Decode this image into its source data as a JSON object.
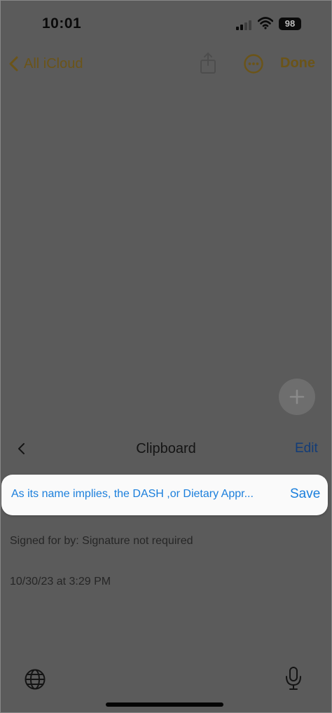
{
  "status_bar": {
    "time": "10:01",
    "battery": "98"
  },
  "nav": {
    "back_label": "All iCloud",
    "done_label": "Done"
  },
  "clipboard": {
    "title": "Clipboard",
    "edit_label": "Edit",
    "current_item": {
      "text": "As its name implies, the DASH ,or Dietary Appr...",
      "save_label": "Save"
    },
    "items": [
      {
        "text": "Signed for by: Signature not required"
      },
      {
        "text": "10/30/23 at 3:29 PM"
      }
    ]
  },
  "colors": {
    "dim_background": "#5b5b5b",
    "dim_accent": "#6b5418",
    "link_blue": "#1b7fdc",
    "card_background": "#fafafa"
  },
  "icons": {
    "back": "chevron-left-icon",
    "share": "share-icon",
    "more": "ellipsis-circle-icon",
    "add": "plus-icon",
    "keyboard_globe": "globe-icon",
    "dictation": "microphone-icon"
  }
}
